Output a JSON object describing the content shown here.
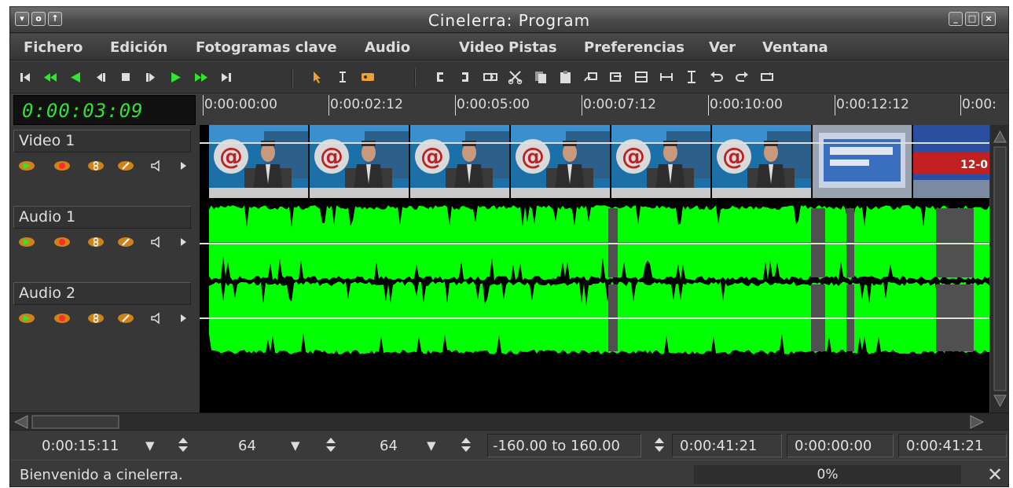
{
  "window": {
    "title": "Cinelerra: Program",
    "left_buttons": [
      "chevron-down-icon",
      "circle-icon",
      "arrow-up-icon"
    ],
    "right_buttons": [
      "minimize-icon",
      "maximize-icon",
      "close-icon"
    ]
  },
  "menu": [
    "Fichero",
    "Edición",
    "Fotogramas clave",
    "Audio",
    "Video",
    "Pistas",
    "Preferencias",
    "Ver",
    "Ventana"
  ],
  "toolbar": {
    "transport": [
      "goto-start-icon",
      "fast-rewind-icon",
      "play-reverse-icon",
      "frame-back-icon",
      "stop-icon",
      "frame-forward-icon",
      "play-icon",
      "fast-forward-icon",
      "goto-end-icon"
    ],
    "edit_modes": [
      "arrow-mode-icon",
      "ibeam-mode-icon",
      "label-mode-icon"
    ],
    "edit_tools": [
      "in-point-icon",
      "out-point-icon",
      "splice-icon",
      "cut-icon",
      "copy-icon",
      "paste-icon",
      "overwrite-icon",
      "lift-icon",
      "extract-icon",
      "fit-icon",
      "toggle-label-icon",
      "undo-icon",
      "redo-icon",
      "loop-icon"
    ],
    "accent": "#2ee82e"
  },
  "timecode": "0:00:03:09",
  "ruler": [
    "0:00:00:00",
    "0:00:02:12",
    "0:00:05:00",
    "0:00:07:12",
    "0:00:10:00",
    "0:00:12:12",
    "0:00:"
  ],
  "tracks": [
    {
      "name": "Video 1",
      "type": "video"
    },
    {
      "name": "Audio 1",
      "type": "audio"
    },
    {
      "name": "Audio 2",
      "type": "audio"
    }
  ],
  "track_controls": [
    "play-track-icon",
    "record-track-icon",
    "gang-icon",
    "draw-icon",
    "mute-icon",
    "expand-icon"
  ],
  "colors": {
    "waveform": "#00ff00",
    "clock": "#34e034",
    "background": "#3d3d3d"
  },
  "bottom": {
    "duration": "0:00:15:11",
    "zoom_audio": "64",
    "zoom_track": "64",
    "range": "-160.00 to 160.00",
    "selection_start": "0:00:41:21",
    "selection_length": "0:00:00:00",
    "selection_end": "0:00:41:21"
  },
  "status": {
    "message": "Bienvenido a cinelerra.",
    "progress": "0%"
  }
}
